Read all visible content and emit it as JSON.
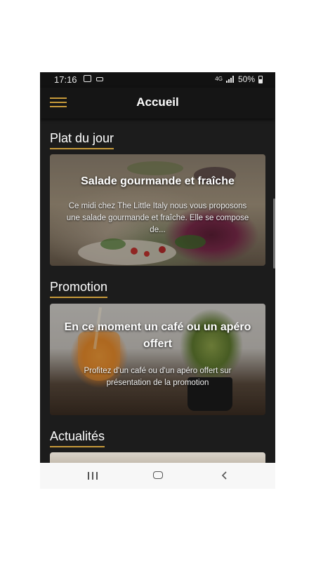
{
  "status_bar": {
    "time": "17:16",
    "network": "4G",
    "battery": "50%"
  },
  "header": {
    "title": "Accueil"
  },
  "sections": [
    {
      "title": "Plat du jour",
      "card": {
        "title": "Salade gourmande et fraîche",
        "description": "Ce midi chez The Little Italy nous vous proposons une salade gourmande et fraîche. Elle se compose de..."
      }
    },
    {
      "title": "Promotion",
      "card": {
        "title": "En ce moment un café ou un apéro offert",
        "description": "Profitez d'un café ou d'un apéro offert sur présentation de la promotion"
      }
    },
    {
      "title": "Actualités"
    }
  ],
  "colors": {
    "accent": "#c79a3a",
    "background": "#1c1c1c",
    "header": "#151515"
  }
}
